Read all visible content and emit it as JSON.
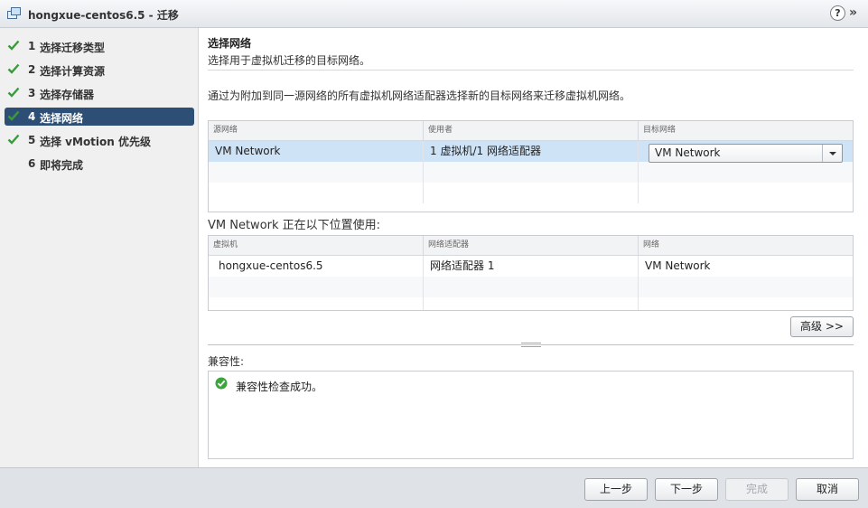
{
  "window": {
    "title": "hongxue-centos6.5 - 迁移",
    "help": "?",
    "expand": "»"
  },
  "steps": [
    {
      "num": "1",
      "label": "选择迁移类型",
      "done": true
    },
    {
      "num": "2",
      "label": "选择计算资源",
      "done": true
    },
    {
      "num": "3",
      "label": "选择存储器",
      "done": true
    },
    {
      "num": "4",
      "label": "选择网络",
      "done": true,
      "active": true
    },
    {
      "num": "5",
      "label": "选择 vMotion 优先级",
      "done": true
    },
    {
      "num": "6",
      "label": "即将完成",
      "done": false
    }
  ],
  "page": {
    "title": "选择网络",
    "subtitle": "选择用于虚拟机迁移的目标网络。",
    "instructions": "通过为附加到同一源网络的所有虚拟机网络适配器选择新的目标网络来迁移虚拟机网络。"
  },
  "network_table": {
    "columns": [
      "源网络",
      "使用者",
      "目标网络"
    ],
    "rows": [
      {
        "source": "VM Network",
        "used_by": "1 虚拟机/1 网络适配器",
        "destination": "VM Network"
      }
    ]
  },
  "usage": {
    "title": "VM Network 正在以下位置使用:",
    "columns": [
      "虚拟机",
      "网络适配器",
      "网络"
    ],
    "rows": [
      {
        "vm": "hongxue-centos6.5",
        "adapter": "网络适配器 1",
        "network": "VM Network"
      }
    ]
  },
  "advanced_button": "高级 >>",
  "compatibility": {
    "label": "兼容性:",
    "message": "兼容性检查成功。",
    "status_color": "#3aa53a"
  },
  "footer": {
    "back": "上一步",
    "next": "下一步",
    "finish": "完成",
    "cancel": "取消"
  },
  "colors": {
    "accent": "#2d4f75",
    "check": "#3c9a3c",
    "selected_row": "#cfe3f7"
  },
  "icons": {
    "title": "vm-icon",
    "steps": "check-icon",
    "help": "help-icon",
    "compat": "success-icon"
  }
}
